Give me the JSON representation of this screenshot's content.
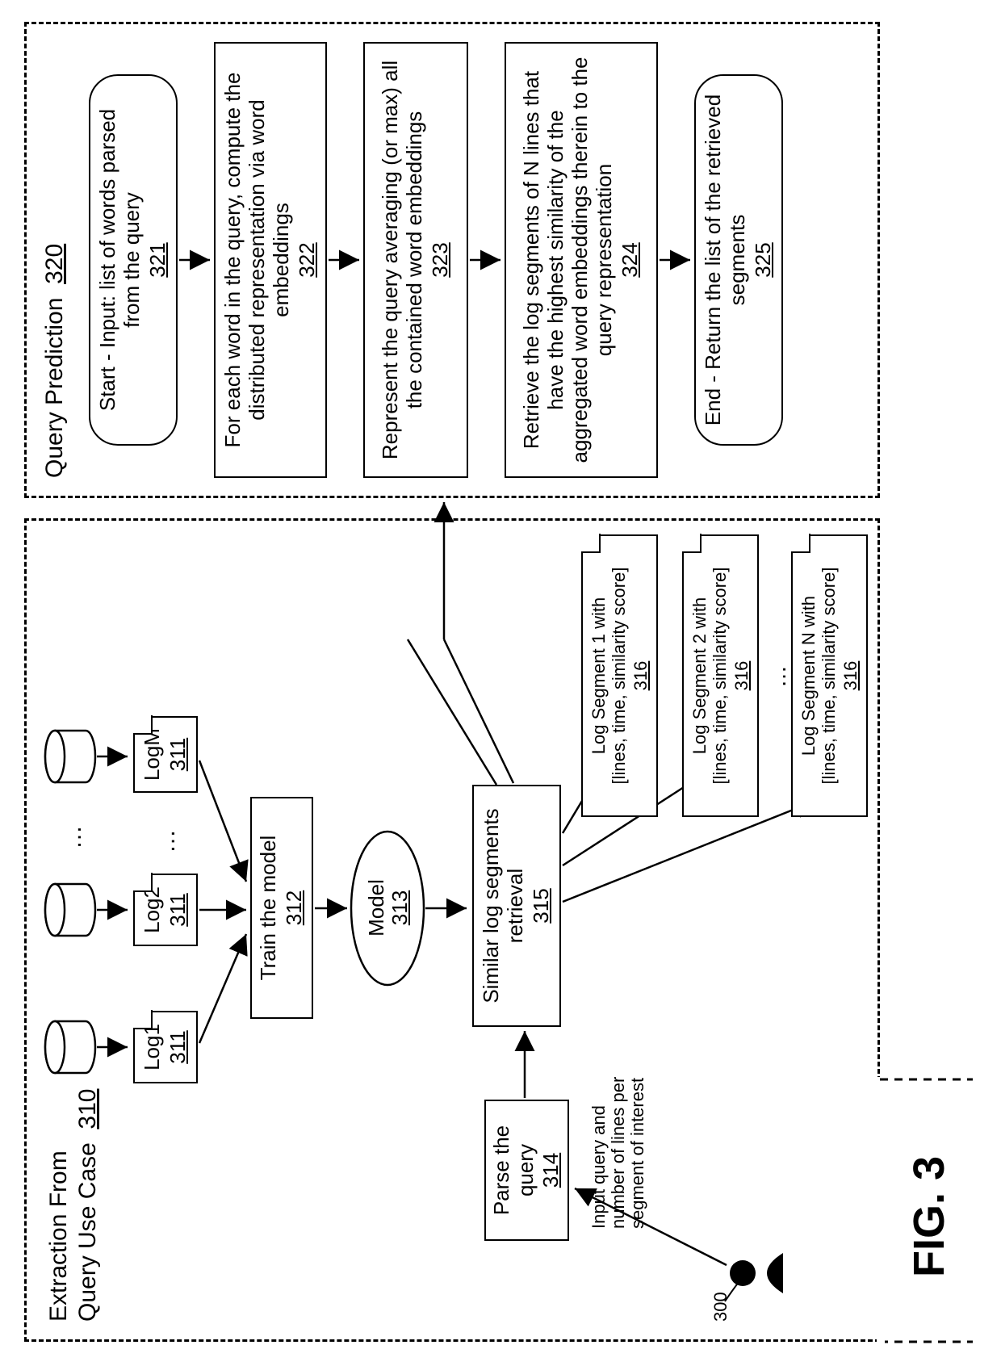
{
  "figure_label": "FIG. 3",
  "panels": {
    "left": {
      "title": "Extraction From Query Use Case",
      "ref": "310"
    },
    "right": {
      "title": "Query Prediction",
      "ref": "320"
    }
  },
  "left": {
    "logs": [
      {
        "name": "Log1",
        "ref": "311"
      },
      {
        "name": "Log2",
        "ref": "311"
      },
      {
        "name": "LogM",
        "ref": "311"
      }
    ],
    "ellipsis": "…",
    "train": {
      "text": "Train the model",
      "ref": "312"
    },
    "model": {
      "text": "Model",
      "ref": "313"
    },
    "parse": {
      "text": "Parse the query",
      "ref": "314"
    },
    "retrieval": {
      "text": "Similar log segments retrieval",
      "ref": "315"
    },
    "segments": [
      {
        "line1": "Log Segment 1 with",
        "line2": "[lines, time, similarity score]",
        "ref": "316"
      },
      {
        "line1": "Log Segment 2 with",
        "line2": "[lines, time, similarity score]",
        "ref": "316"
      },
      {
        "line1": "Log Segment N with",
        "line2": "[lines, time, similarity score]",
        "ref": "316"
      }
    ],
    "seg_ellipsis": "…",
    "input_note": "Input query and number of lines per segment of interest",
    "actor_ref": "300"
  },
  "right": {
    "steps": [
      {
        "text": "Start - Input: list of words parsed from the query",
        "ref": "321",
        "rounded": true
      },
      {
        "text": "For each word in the query, compute the distributed representation via word embeddings",
        "ref": "322",
        "rounded": false
      },
      {
        "text": "Represent the query averaging (or max) all the contained word embeddings",
        "ref": "323",
        "rounded": false
      },
      {
        "text": "Retrieve the log segments of N lines that have the highest similarity of the aggregated word embeddings therein to the query representation",
        "ref": "324",
        "rounded": false
      },
      {
        "text": "End - Return the list of the retrieved segments",
        "ref": "325",
        "rounded": true
      }
    ]
  }
}
